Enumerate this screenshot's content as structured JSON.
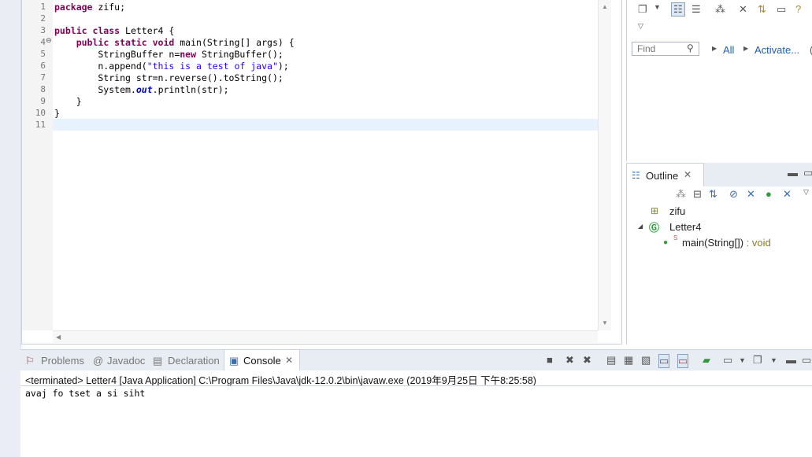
{
  "editor": {
    "line_numbers": [
      "1",
      "2",
      "3",
      "4",
      "5",
      "6",
      "7",
      "8",
      "9",
      "10",
      "11"
    ],
    "fold_marker": "⊖",
    "lines": [
      [
        {
          "t": "package",
          "c": "kw"
        },
        {
          "t": " zifu;"
        }
      ],
      [],
      [
        {
          "t": "public class",
          "c": "kw"
        },
        {
          "t": " Letter4 {"
        }
      ],
      [
        {
          "t": "    "
        },
        {
          "t": "public static void",
          "c": "kw"
        },
        {
          "t": " main(String[] args) {"
        }
      ],
      [
        {
          "t": "        StringBuffer n="
        },
        {
          "t": "new",
          "c": "kw"
        },
        {
          "t": " StringBuffer();"
        }
      ],
      [
        {
          "t": "        n.append("
        },
        {
          "t": "\"this is a test of java\"",
          "c": "str"
        },
        {
          "t": ");"
        }
      ],
      [
        {
          "t": "        String str=n.reverse().toString();"
        }
      ],
      [
        {
          "t": "        System."
        },
        {
          "t": "out",
          "c": "fld"
        },
        {
          "t": ".println(str);"
        }
      ],
      [
        {
          "t": "    }"
        }
      ],
      [
        {
          "t": "}"
        }
      ],
      []
    ]
  },
  "right_panel": {
    "find_placeholder": "Find",
    "all_label": "All",
    "activate_label": "Activate...",
    "paren_label": "("
  },
  "outline": {
    "tab_label": "Outline",
    "package_name": "zifu",
    "class_name": "Letter4",
    "method_name": "main(String[])",
    "method_return": " : void",
    "static_marker": "S"
  },
  "console": {
    "tabs": {
      "problems": "Problems",
      "javadoc": "Javadoc",
      "declaration": "Declaration",
      "console": "Console"
    },
    "status": "<terminated> Letter4 [Java Application] C:\\Program Files\\Java\\jdk-12.0.2\\bin\\javaw.exe (2019年9月25日 下午8:25:58)",
    "output": "avaj fo tset a si siht"
  },
  "colors": {
    "keyword": "#7f0055",
    "string": "#2a00ff",
    "field": "#0000c0",
    "link": "#1f5fa8",
    "current_line": "#e8f2fe"
  }
}
